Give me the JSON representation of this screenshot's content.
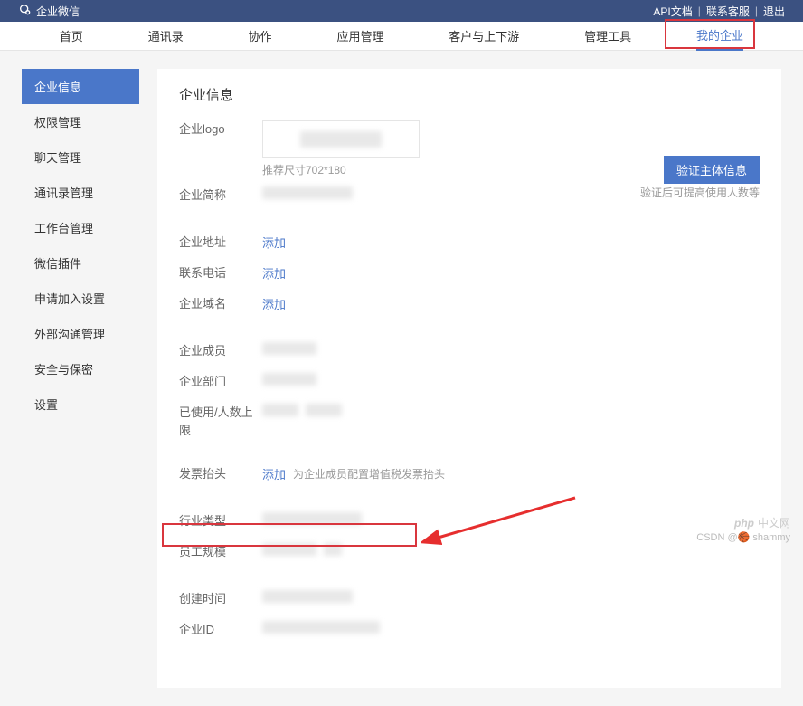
{
  "topbar": {
    "brand": "企业微信",
    "links": [
      "API文档",
      "联系客服",
      "退出"
    ]
  },
  "nav": {
    "items": [
      "首页",
      "通讯录",
      "协作",
      "应用管理",
      "客户与上下游",
      "管理工具",
      "我的企业"
    ],
    "active_index": 6
  },
  "sidebar": {
    "items": [
      "企业信息",
      "权限管理",
      "聊天管理",
      "通讯录管理",
      "工作台管理",
      "微信插件",
      "申请加入设置",
      "外部沟通管理",
      "安全与保密",
      "设置"
    ],
    "active_index": 0
  },
  "page": {
    "title": "企业信息",
    "logo_label": "企业logo",
    "logo_recommend": "推荐尺寸702*180",
    "verify_btn": "验证主体信息",
    "verify_hint": "验证后可提高使用人数等",
    "fields": {
      "name": {
        "label": "企业简称"
      },
      "address": {
        "label": "企业地址",
        "action": "添加"
      },
      "phone": {
        "label": "联系电话",
        "action": "添加"
      },
      "domain": {
        "label": "企业域名",
        "action": "添加"
      },
      "members": {
        "label": "企业成员"
      },
      "departments": {
        "label": "企业部门"
      },
      "usage": {
        "label": "已使用/人数上限"
      },
      "invoice": {
        "label": "发票抬头",
        "action": "添加",
        "hint": "为企业成员配置增值税发票抬头"
      },
      "industry": {
        "label": "行业类型"
      },
      "scale": {
        "label": "员工规模"
      },
      "created": {
        "label": "创建时间"
      },
      "corpid": {
        "label": "企业ID"
      }
    }
  },
  "watermark": {
    "php": "中文网",
    "csdn": "CSDN @🏀 shammy"
  }
}
